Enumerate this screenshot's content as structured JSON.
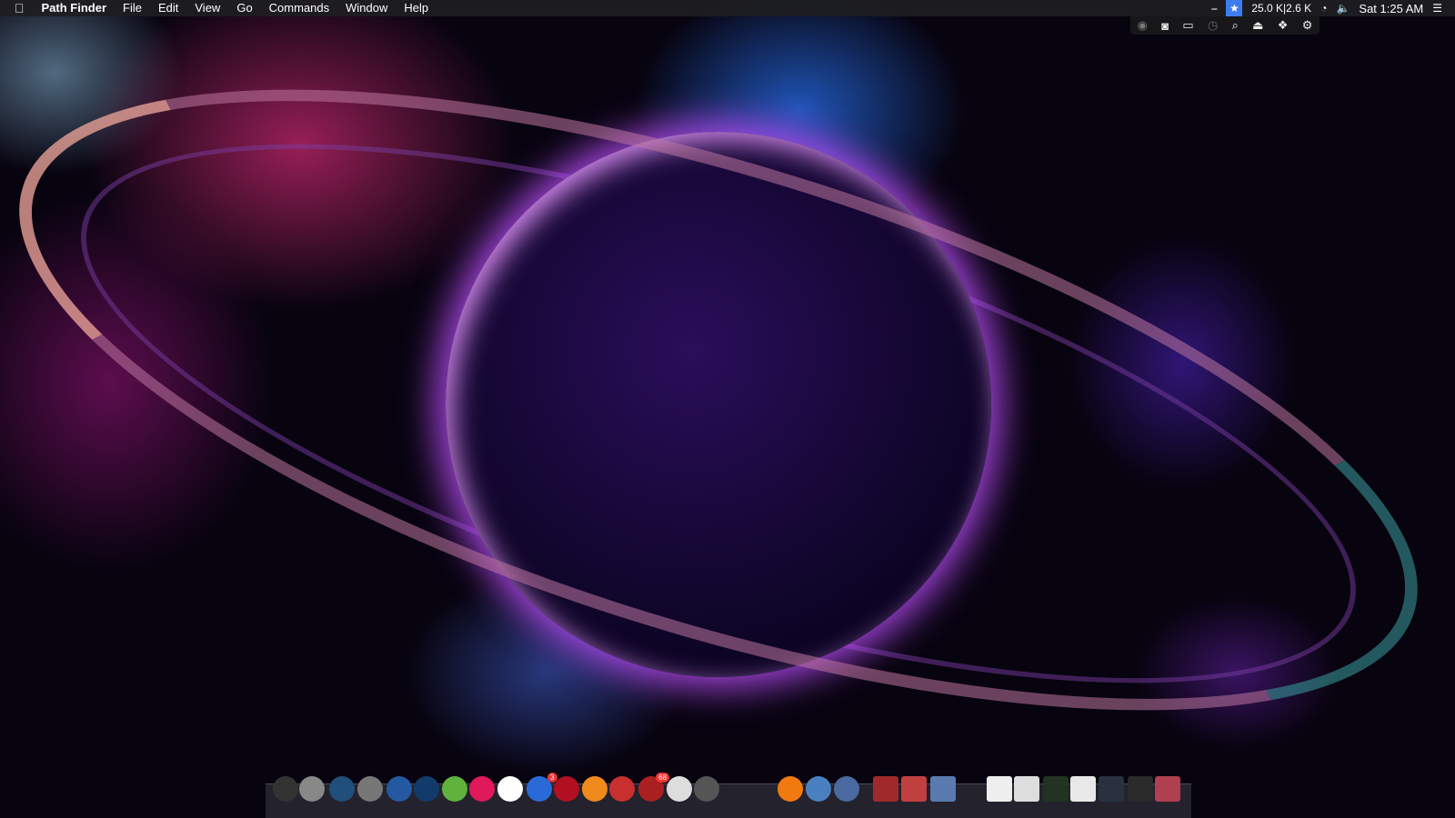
{
  "menubar": {
    "app_name": "Path Finder",
    "menus": [
      "File",
      "Edit",
      "View",
      "Go",
      "Commands",
      "Window",
      "Help"
    ],
    "network": "25.0 K|2.6 K",
    "clock": "Sat 1:25 AM"
  },
  "tray_icons": [
    "app-icon",
    "timer-icon",
    "airplay-icon",
    "time-machine-icon",
    "search-icon",
    "eject-icon",
    "dropbox-icon",
    "gear-icon"
  ],
  "dock": {
    "apps": [
      {
        "name": "x-app",
        "bg": "#333"
      },
      {
        "name": "quicktime",
        "bg": "#888"
      },
      {
        "name": "launchpad",
        "bg": "#1f4f7a"
      },
      {
        "name": "direct-mail",
        "bg": "#777"
      },
      {
        "name": "firefox",
        "bg": "#2458a0"
      },
      {
        "name": "scanner",
        "bg": "#123a6a"
      },
      {
        "name": "utorrent",
        "bg": "#5fb33c"
      },
      {
        "name": "flickr-pink",
        "bg": "#e0195a"
      },
      {
        "name": "flickr-white",
        "bg": "#ffffff"
      },
      {
        "name": "app-store",
        "bg": "#2a6ad8",
        "badge": "3"
      },
      {
        "name": "music-boot",
        "bg": "#b01020"
      },
      {
        "name": "ibooks",
        "bg": "#f08a1c"
      },
      {
        "name": "santa",
        "bg": "#c83030"
      },
      {
        "name": "mickey",
        "bg": "#aa2020",
        "badge": "68"
      },
      {
        "name": "snowman",
        "bg": "#ddd"
      },
      {
        "name": "system-preferences",
        "bg": "#555"
      },
      {
        "name": "media-player",
        "bg": "#f07a10"
      },
      {
        "name": "molecule-app",
        "bg": "#4a80c0"
      },
      {
        "name": "preview",
        "bg": "#4a6aa0"
      },
      {
        "name": "christmas-folder-1",
        "bg": "#a02a2a"
      },
      {
        "name": "christmas-folder-2",
        "bg": "#c04040"
      },
      {
        "name": "screenshot-app",
        "bg": "#5a7ab0"
      },
      {
        "name": "window-1",
        "bg": "#eeeeee"
      },
      {
        "name": "window-2",
        "bg": "#dddddd"
      },
      {
        "name": "window-3",
        "bg": "#223322"
      },
      {
        "name": "window-4",
        "bg": "#e8e8e8"
      },
      {
        "name": "window-5",
        "bg": "#2a3040"
      },
      {
        "name": "window-6",
        "bg": "#2a2a2a"
      },
      {
        "name": "trash",
        "bg": "#b04050"
      }
    ]
  }
}
